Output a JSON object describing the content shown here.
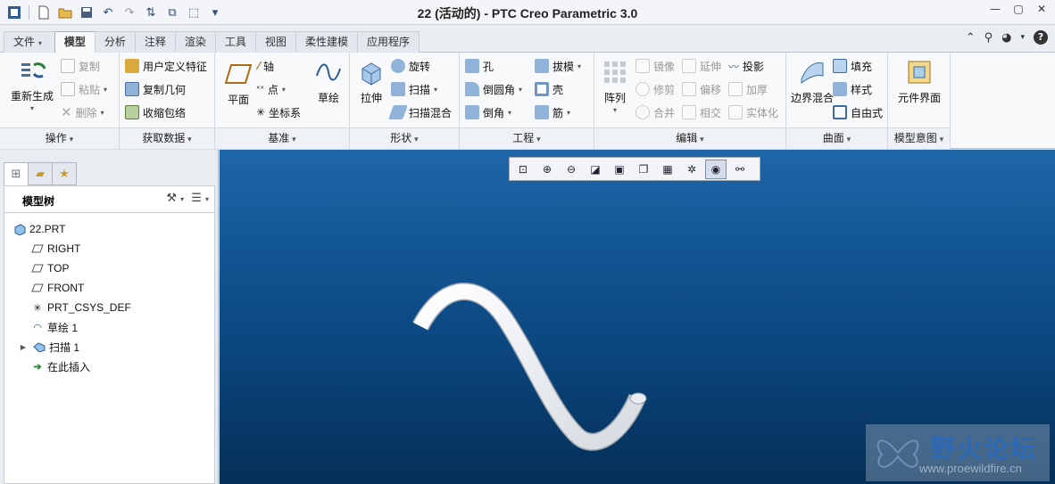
{
  "window": {
    "title": "22 (活动的) - PTC Creo Parametric 3.0"
  },
  "tabs": [
    {
      "label": "文件",
      "dropdown": true
    },
    {
      "label": "模型",
      "active": true
    },
    {
      "label": "分析"
    },
    {
      "label": "注释"
    },
    {
      "label": "渲染"
    },
    {
      "label": "工具"
    },
    {
      "label": "视图"
    },
    {
      "label": "柔性建模"
    },
    {
      "label": "应用程序"
    }
  ],
  "ribbon": {
    "ops": {
      "title": "操作",
      "regen": "重新生成",
      "copy": "复制",
      "paste": "粘贴",
      "delete": "删除"
    },
    "getdata": {
      "title": "获取数据",
      "udf": "用户定义特征",
      "copy_geom": "复制几何",
      "shrinkwrap": "收缩包络"
    },
    "datum": {
      "title": "基准",
      "plane": "平面",
      "axis": "轴",
      "point": "点",
      "csys": "坐标系",
      "sketch": "草绘"
    },
    "shapes": {
      "title": "形状",
      "extrude": "拉伸",
      "revolve": "旋转",
      "sweep": "扫描",
      "swept_blend": "扫描混合"
    },
    "engineering": {
      "title": "工程",
      "hole": "孔",
      "round": "倒圆角",
      "chamfer": "倒角",
      "draft": "拔模",
      "shell": "壳",
      "rib": "筋"
    },
    "editing": {
      "title": "编辑",
      "pattern": "阵列",
      "mirror": "镜像",
      "trim": "修剪",
      "merge": "合并",
      "extend": "延伸",
      "offset": "偏移",
      "intersect": "相交",
      "project": "投影",
      "thicken": "加厚",
      "solidify": "实体化"
    },
    "surfaces": {
      "title": "曲面",
      "boundary_blend": "边界混合",
      "fill": "填充",
      "style": "样式",
      "freestyle": "自由式"
    },
    "intent": {
      "title": "模型意图",
      "component_interface": "元件界面"
    }
  },
  "model_tree": {
    "title": "模型树",
    "items": [
      {
        "label": "22.PRT",
        "icon": "part-icon"
      },
      {
        "label": "RIGHT",
        "icon": "datum-plane-icon"
      },
      {
        "label": "TOP",
        "icon": "datum-plane-icon"
      },
      {
        "label": "FRONT",
        "icon": "datum-plane-icon"
      },
      {
        "label": "PRT_CSYS_DEF",
        "icon": "csys-icon"
      },
      {
        "label": "草绘 1",
        "icon": "sketch-icon"
      },
      {
        "label": "扫描 1",
        "icon": "sweep-icon",
        "expandable": true
      },
      {
        "label": "在此插入",
        "icon": "insert-arrow-icon"
      }
    ]
  },
  "watermark": {
    "text": "野火论坛",
    "url": "www.proewildfire.cn"
  },
  "colors": {
    "viewport_top": "#1f66a8",
    "viewport_bottom": "#052f57",
    "accent": "#2b69b6"
  }
}
